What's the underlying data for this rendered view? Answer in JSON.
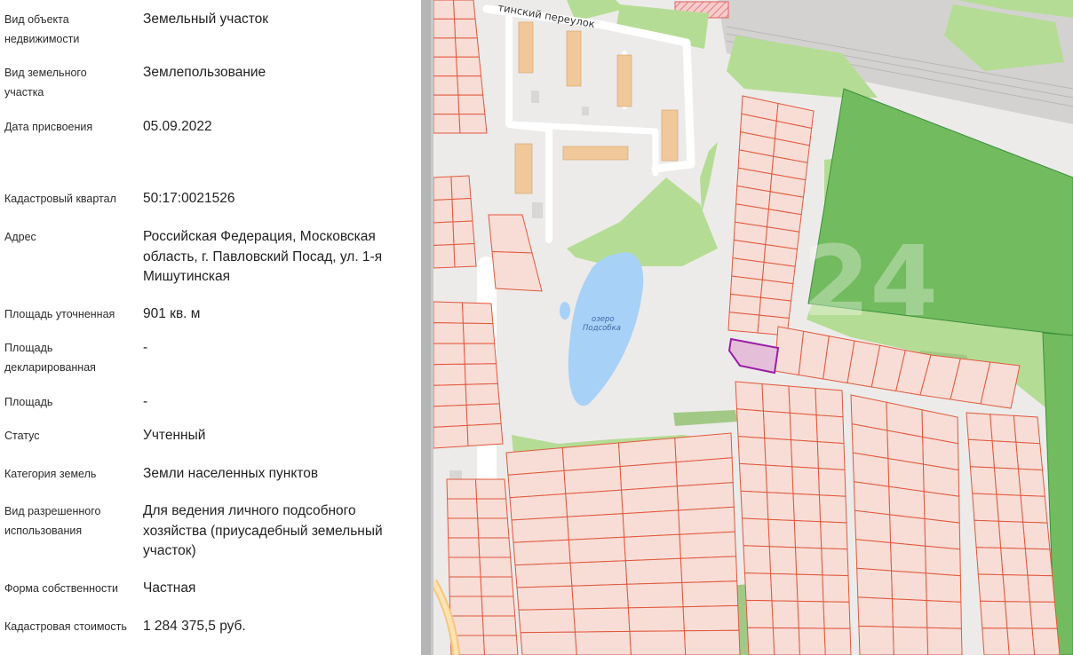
{
  "fields": [
    {
      "label": "Вид объекта недвижимости",
      "value": "Земельный участок"
    },
    {
      "label": "Вид земельного участка",
      "value": "Землепользование"
    },
    {
      "label": "Дата присвоения",
      "value": "05.09.2022"
    },
    {
      "label": "Кадастровый квартал",
      "value": "50:17:0021526"
    },
    {
      "label": "Адрес",
      "value": "Российская Федерация, Московская область, г. Павловский Посад, ул. 1-я Мишутинская"
    },
    {
      "label": "Площадь уточненная",
      "value": "901 кв. м"
    },
    {
      "label": "Площадь декларированная",
      "value": "-"
    },
    {
      "label": "Площадь",
      "value": "-"
    },
    {
      "label": "Статус",
      "value": "Учтенный"
    },
    {
      "label": "Категория земель",
      "value": "Земли населенных пунктов"
    },
    {
      "label": "Вид разрешенного использования",
      "value": "Для ведения личного подсобного хозяйства (приусадебный земельный участок)"
    },
    {
      "label": "Форма собственности",
      "value": "Частная"
    },
    {
      "label": "Кадастровая стоимость",
      "value": "1 284 375,5 руб."
    }
  ],
  "map": {
    "street_label": "тинский переулок",
    "lake_label_line1": "озеро",
    "lake_label_line2": "Подсобка",
    "watermark": "24",
    "colors": {
      "parcel_fill": "#f7ddd6",
      "parcel_stroke": "#e2583c",
      "selected_fill": "#e5bfd9",
      "selected_stroke": "#9a1ea6",
      "forest": "#72bb5f",
      "green": "#b5dc94",
      "water": "#a8d1f7",
      "building": "#f0c89a"
    }
  }
}
